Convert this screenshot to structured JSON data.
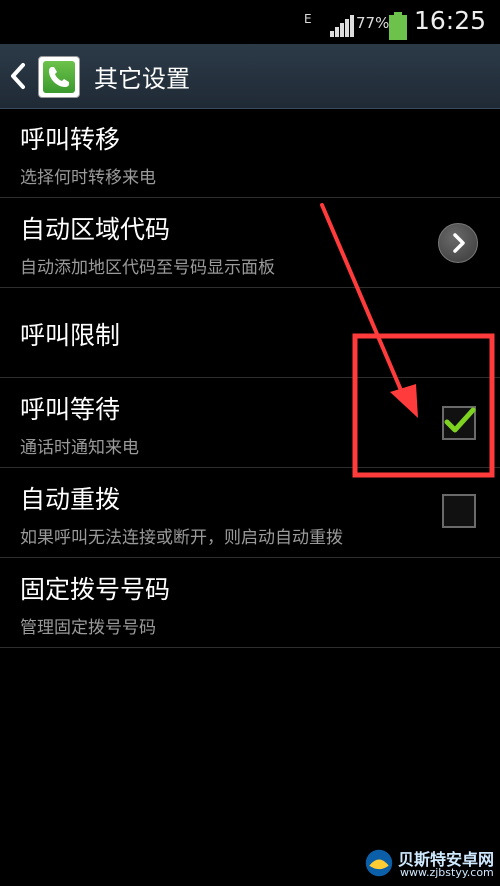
{
  "status_bar": {
    "network": "E",
    "battery_pct": "77%",
    "time": "16:25"
  },
  "action_bar": {
    "title": "其它设置"
  },
  "settings": [
    {
      "title": "呼叫转移",
      "summary": "选择何时转移来电"
    },
    {
      "title": "自动区域代码",
      "summary": "自动添加地区代码至号码显示面板"
    },
    {
      "title": "呼叫限制"
    },
    {
      "title": "呼叫等待",
      "summary": "通话时通知来电",
      "checked": true
    },
    {
      "title": "自动重拨",
      "summary": "如果呼叫无法连接或断开，则启动自动重拨",
      "checked": false
    },
    {
      "title": "固定拨号号码",
      "summary": "管理固定拨号号码"
    }
  ],
  "watermark": {
    "name": "贝斯特安卓网",
    "url": "www.zjbstyy.com"
  },
  "colors": {
    "checkmark": "#7ed321",
    "annotation": "#ff3b3b",
    "action_bar": "#243240"
  }
}
